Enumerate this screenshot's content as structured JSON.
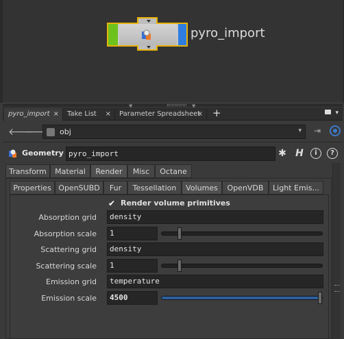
{
  "network": {
    "node_name": "pyro_import"
  },
  "tabbar": {
    "tabs": [
      {
        "label": "pyro_import",
        "close": "×"
      },
      {
        "label": "Take List",
        "close": "×"
      },
      {
        "label": "Parameter Spreadsheet",
        "close": "×"
      }
    ],
    "add": "+",
    "menu_arrow": "▾"
  },
  "pathbar": {
    "back_icon": "arrow-left-icon",
    "forward_icon": "arrow-right-icon",
    "path": "obj",
    "dropdown_glyph": "▾"
  },
  "header": {
    "type_label": "Geometry",
    "node_name": "pyro_import",
    "gear": "✱",
    "help_h": "H",
    "info": "i",
    "question": "?"
  },
  "outer_tabs": [
    {
      "label": "Transform",
      "active": false
    },
    {
      "label": "Material",
      "active": false
    },
    {
      "label": "Render",
      "active": true
    },
    {
      "label": "Misc",
      "active": false
    },
    {
      "label": "Octane",
      "active": false
    }
  ],
  "inner_tabs": [
    {
      "label": "Properties",
      "active": false
    },
    {
      "label": "OpenSUBD",
      "active": false
    },
    {
      "label": "Fur",
      "active": false
    },
    {
      "label": "Tessellation",
      "active": false
    },
    {
      "label": "Volumes",
      "active": true
    },
    {
      "label": "OpenVDB",
      "active": false
    },
    {
      "label": "Light Emis...",
      "active": false
    }
  ],
  "volumes": {
    "render_volume_primitives": {
      "label": "Render volume primitives",
      "checked": true,
      "glyph": "✔"
    },
    "absorption_grid": {
      "label": "Absorption grid",
      "value": "density"
    },
    "absorption_scale": {
      "label": "Absorption scale",
      "value": "1",
      "slider_fraction": 0.1
    },
    "scattering_grid": {
      "label": "Scattering grid",
      "value": "density"
    },
    "scattering_scale": {
      "label": "Scattering scale",
      "value": "1",
      "slider_fraction": 0.1
    },
    "emission_grid": {
      "label": "Emission grid",
      "value": "temperature"
    },
    "emission_scale": {
      "label": "Emission scale",
      "value": "4500",
      "slider_fraction": 1.0
    }
  },
  "colors": {
    "selection": "#e8b20a",
    "display_flag": "#2f7de0",
    "render_flag": "#6ec21c",
    "slider_fill": "#2e5e9e"
  }
}
